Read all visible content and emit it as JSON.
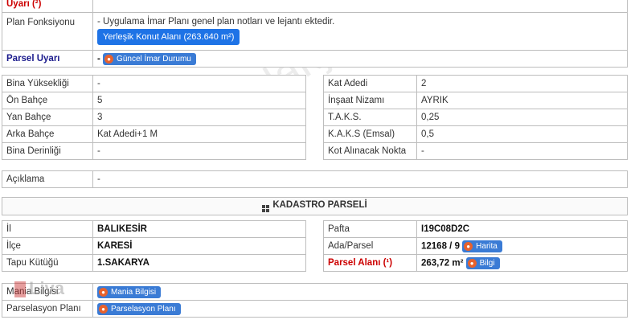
{
  "top": {
    "uyari_label": "Uyarı (²)",
    "plan_fonksiyonu_label": "Plan Fonksiyonu",
    "plan_fonksiyonu_text": "- Uygulama İmar Planı genel plan notları ve lejantı ektedir.",
    "plan_button": "Yerleşik Konut Alanı (263.640 m²)",
    "parsel_uyari_label": "Parsel Uyarı",
    "parsel_uyari_dash": "-",
    "guncel_imar_button": "Güncel İmar Durumu"
  },
  "details_left": [
    {
      "label": "Bina Yüksekliği",
      "value": "-"
    },
    {
      "label": "Ön Bahçe",
      "value": "5"
    },
    {
      "label": "Yan Bahçe",
      "value": "3"
    },
    {
      "label": "Arka Bahçe",
      "value": "Kat Adedi+1 M"
    },
    {
      "label": "Bina Derinliği",
      "value": "-"
    }
  ],
  "details_right": [
    {
      "label": "Kat Adedi",
      "value": "2"
    },
    {
      "label": "İnşaat Nizamı",
      "value": "AYRIK"
    },
    {
      "label": "T.A.K.S.",
      "value": "0,25"
    },
    {
      "label": "K.A.K.S (Emsal)",
      "value": "0,5"
    },
    {
      "label": "Kot Alınacak Nokta",
      "value": "-"
    }
  ],
  "aciklama": {
    "label": "Açıklama",
    "value": "-"
  },
  "kadastro_title": "KADASTRO PARSELİ",
  "kadastro_left": [
    {
      "label": "İl",
      "value": "BALIKESİR"
    },
    {
      "label": "İlçe",
      "value": "KARESİ"
    },
    {
      "label": "Tapu Kütüğü",
      "value": "1.SAKARYA"
    }
  ],
  "kadastro_right": {
    "pafta_label": "Pafta",
    "pafta_value": "I19C08D2C",
    "ada_label": "Ada/Parsel",
    "ada_value": "12168 / 9",
    "harita_button": "Harita",
    "alan_label": "Parsel Alanı (¹)",
    "alan_value": "263,72 m²",
    "bilgi_button": "Bilgi"
  },
  "bottom": {
    "mania_label": "Mania Bilgisi",
    "mania_button": "Mania Bilgisi",
    "parselasyon_label": "Parselasyon Planı",
    "parselasyon_button": "Parselasyon Planı"
  },
  "watermark": "emlakjet",
  "logo": "Liva"
}
